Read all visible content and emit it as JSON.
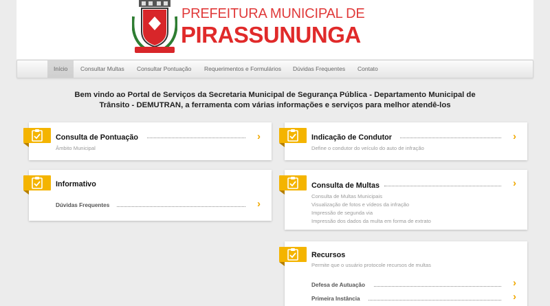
{
  "brand": {
    "line1": "PREFEITURA MUNICIPAL DE",
    "line2": "PIRASSUNUNGA",
    "colors": {
      "red": "#e02a2a",
      "accent": "#f4b400"
    }
  },
  "nav": [
    {
      "label": "Início",
      "active": true
    },
    {
      "label": "Consultar Multas",
      "active": false
    },
    {
      "label": "Consultar Pontuação",
      "active": false
    },
    {
      "label": "Requerimentos e Formulários",
      "active": false
    },
    {
      "label": "Dúvidas Frequentes",
      "active": false
    },
    {
      "label": "Contato",
      "active": false
    }
  ],
  "welcome": {
    "line1": "Bem vindo ao Portal de Serviços da Secretaria Municipal de Segurança Pública - Departamento Municipal de",
    "line2": "Trânsito - DEMUTRAN, a ferramenta com várias informações e serviços para melhor atendê-los"
  },
  "cards": {
    "pontuacao": {
      "title": "Consulta de Pontuação",
      "subtitle": "Âmbito Municipal"
    },
    "condutor": {
      "title": "Indicação de Condutor",
      "subtitle": "Define o condutor do veículo do auto de infração"
    },
    "informativo": {
      "title": "Informativo",
      "link": "Dúvidas Frequentes"
    },
    "multas": {
      "title": "Consulta de Multas",
      "lines": [
        "Consulta de Multas Municipais",
        "Visualização de fotos e vídeos da infração",
        "Impressão de segunda via",
        "Impressão dos dados da multa em forma de extrato"
      ]
    },
    "recursos": {
      "title": "Recursos",
      "subtitle": "Permite que o usuário protocole recursos de multas",
      "links": [
        "Defesa de Autuação",
        "Primeira Instância"
      ]
    }
  },
  "icons": {
    "badge": "clipboard-check-icon",
    "arrow": "chevron-right-icon"
  }
}
